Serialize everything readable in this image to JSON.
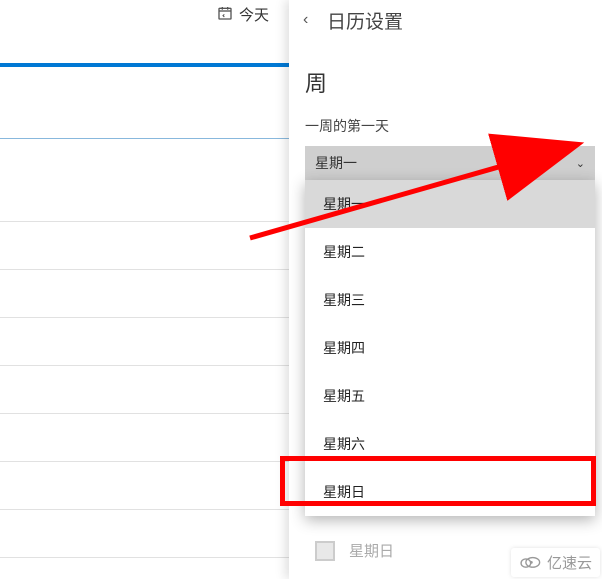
{
  "left": {
    "today_label": "今天"
  },
  "settings": {
    "title": "日历设置",
    "week_section": "周",
    "first_day_label": "一周的第一天",
    "selected": "星期一",
    "options": [
      "星期一",
      "星期二",
      "星期三",
      "星期四",
      "星期五",
      "星期六",
      "星期日"
    ],
    "disabled_checkbox_label": "星期日"
  },
  "watermark": "亿速云",
  "row_tops": [
    221,
    269,
    317,
    365,
    413,
    461,
    509,
    557
  ],
  "colors": {
    "accent": "#0078d4",
    "annotation": "#ff0000"
  }
}
